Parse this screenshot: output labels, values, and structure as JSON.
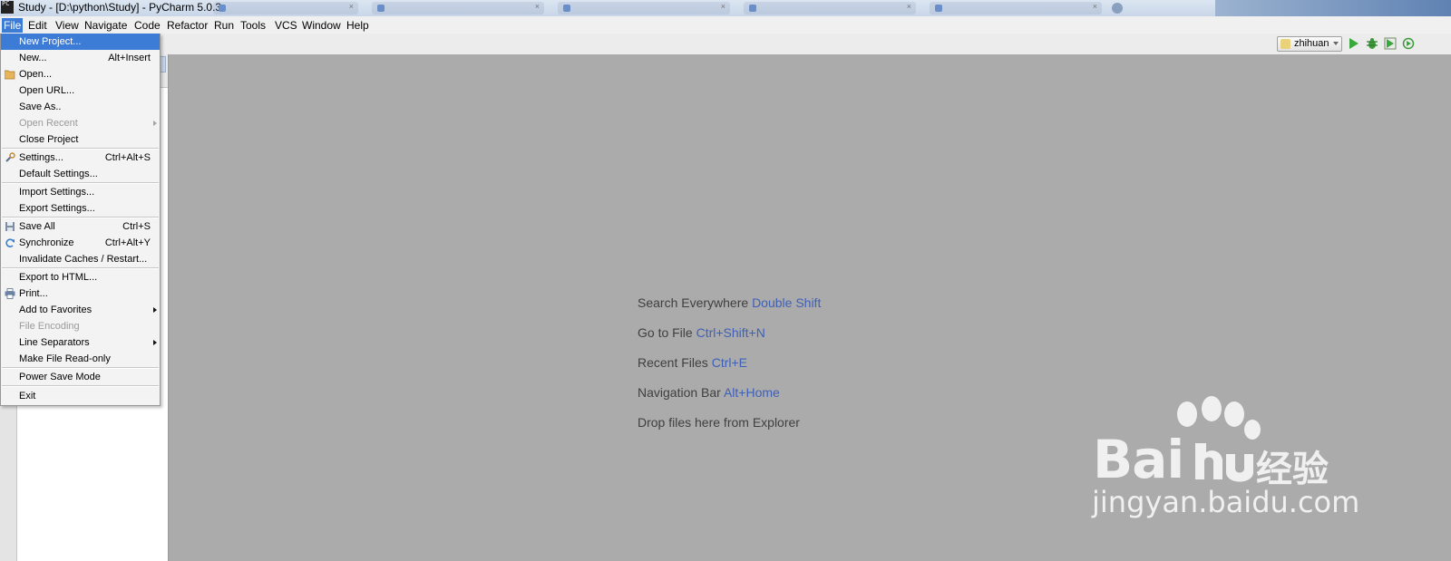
{
  "window": {
    "title": "Study - [D:\\python\\Study] - PyCharm 5.0.3",
    "app_icon_text": "PC"
  },
  "menubar": [
    {
      "label": "File"
    },
    {
      "label": "Edit"
    },
    {
      "label": "View"
    },
    {
      "label": "Navigate"
    },
    {
      "label": "Code"
    },
    {
      "label": "Refactor"
    },
    {
      "label": "Run"
    },
    {
      "label": "Tools"
    },
    {
      "label": "VCS"
    },
    {
      "label": "Window"
    },
    {
      "label": "Help"
    }
  ],
  "toolbar": {
    "run_config": "zhihuan"
  },
  "file_menu": [
    {
      "label": "New Project...",
      "shortcut": ""
    },
    {
      "label": "New...",
      "shortcut": "Alt+Insert"
    },
    {
      "label": "Open...",
      "shortcut": ""
    },
    {
      "label": "Open URL...",
      "shortcut": ""
    },
    {
      "label": "Save As..",
      "shortcut": ""
    },
    {
      "label": "Open Recent",
      "shortcut": ""
    },
    {
      "label": "Close Project",
      "shortcut": ""
    },
    {
      "label": "Settings...",
      "shortcut": "Ctrl+Alt+S"
    },
    {
      "label": "Default Settings...",
      "shortcut": ""
    },
    {
      "label": "Import Settings...",
      "shortcut": ""
    },
    {
      "label": "Export Settings...",
      "shortcut": ""
    },
    {
      "label": "Save All",
      "shortcut": "Ctrl+S"
    },
    {
      "label": "Synchronize",
      "shortcut": "Ctrl+Alt+Y"
    },
    {
      "label": "Invalidate Caches / Restart...",
      "shortcut": ""
    },
    {
      "label": "Export to HTML...",
      "shortcut": ""
    },
    {
      "label": "Print...",
      "shortcut": ""
    },
    {
      "label": "Add to Favorites",
      "shortcut": ""
    },
    {
      "label": "File Encoding",
      "shortcut": ""
    },
    {
      "label": "Line Separators",
      "shortcut": ""
    },
    {
      "label": "Make File Read-only",
      "shortcut": ""
    },
    {
      "label": "Power Save Mode",
      "shortcut": ""
    },
    {
      "label": "Exit",
      "shortcut": ""
    }
  ],
  "editor_hints": [
    {
      "text": "Search Everywhere",
      "key": "Double Shift"
    },
    {
      "text": "Go to File",
      "key": "Ctrl+Shift+N"
    },
    {
      "text": "Recent Files",
      "key": "Ctrl+E"
    },
    {
      "text": "Navigation Bar",
      "key": "Alt+Home"
    },
    {
      "text": "Drop files here from Explorer",
      "key": ""
    }
  ],
  "watermark": {
    "brand": "Bai",
    "brand_cn": "经验",
    "url": "jingyan.baidu.com"
  },
  "colors": {
    "menu_highlight": "#3c7bd6",
    "editor_bg": "#ababab",
    "shortcut_key": "#3f60b7"
  }
}
